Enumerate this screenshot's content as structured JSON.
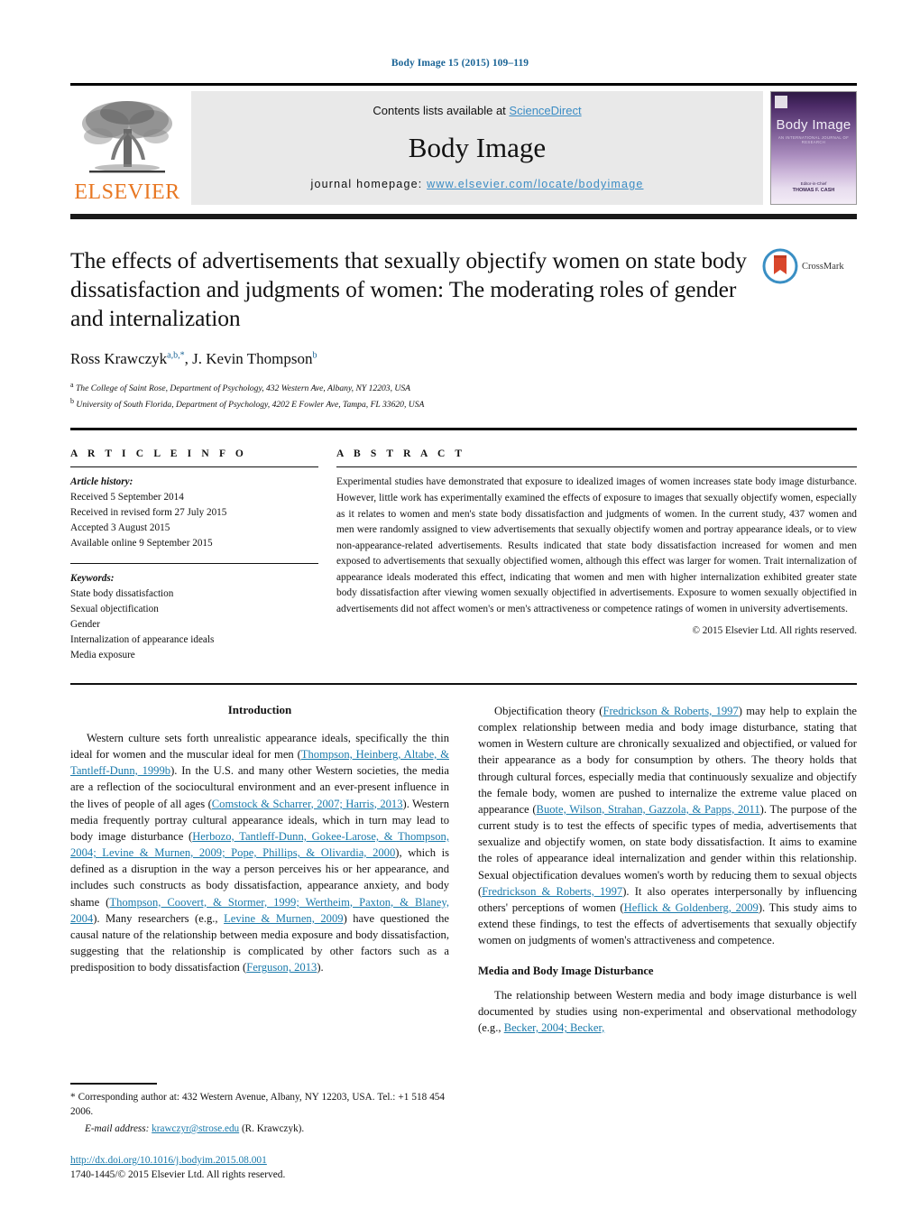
{
  "running_head": "Body Image 15 (2015) 109–119",
  "masthead": {
    "contents_prefix": "Contents lists available at ",
    "sciencedirect": "ScienceDirect",
    "journal_title": "Body Image",
    "homepage_prefix": "journal homepage: ",
    "homepage_url": "www.elsevier.com/locate/bodyimage",
    "publisher_wordmark": "ELSEVIER",
    "publisher_color": "#E87722",
    "cover": {
      "title": "Body Image",
      "subtitle": "AN INTERNATIONAL JOURNAL OF RESEARCH",
      "footer_label": "Editor-in-Chief",
      "footer_name": "THOMAS F. CASH"
    }
  },
  "article": {
    "title": "The effects of advertisements that sexually objectify women on state body dissatisfaction and judgments of women: The moderating roles of gender and internalization",
    "authors": [
      {
        "name": "Ross Krawczyk",
        "marks": "a,b,*"
      },
      {
        "name": "J. Kevin Thompson",
        "marks": "b"
      }
    ],
    "affiliations": [
      {
        "mark": "a",
        "text": "The College of Saint Rose, Department of Psychology, 432 Western Ave, Albany, NY 12203, USA"
      },
      {
        "mark": "b",
        "text": "University of South Florida, Department of Psychology, 4202 E Fowler Ave, Tampa, FL 33620, USA"
      }
    ],
    "crossmark_label": "CrossMark"
  },
  "article_info": {
    "heading": "A R T I C L E   I N F O",
    "history_label": "Article history:",
    "history": [
      "Received 5 September 2014",
      "Received in revised form 27 July 2015",
      "Accepted 3 August 2015",
      "Available online 9 September 2015"
    ],
    "keywords_label": "Keywords:",
    "keywords": [
      "State body dissatisfaction",
      "Sexual objectification",
      "Gender",
      "Internalization of appearance ideals",
      "Media exposure"
    ]
  },
  "abstract": {
    "heading": "A B S T R A C T",
    "text": "Experimental studies have demonstrated that exposure to idealized images of women increases state body image disturbance. However, little work has experimentally examined the effects of exposure to images that sexually objectify women, especially as it relates to women and men's state body dissatisfaction and judgments of women. In the current study, 437 women and men were randomly assigned to view advertisements that sexually objectify women and portray appearance ideals, or to view non-appearance-related advertisements. Results indicated that state body dissatisfaction increased for women and men exposed to advertisements that sexually objectified women, although this effect was larger for women. Trait internalization of appearance ideals moderated this effect, indicating that women and men with higher internalization exhibited greater state body dissatisfaction after viewing women sexually objectified in advertisements. Exposure to women sexually objectified in advertisements did not affect women's or men's attractiveness or competence ratings of women in university advertisements.",
    "copyright": "© 2015 Elsevier Ltd. All rights reserved."
  },
  "body": {
    "left_heading": "Introduction",
    "left_p1_parts": [
      {
        "t": "Western culture sets forth unrealistic appearance ideals, specifically the thin ideal for women and the muscular ideal for men (",
        "k": "plain"
      },
      {
        "t": "Thompson, Heinberg, Altabe, & Tantleff-Dunn, 1999b",
        "k": "ref"
      },
      {
        "t": "). In the U.S. and many other Western societies, the media are a reflection of the sociocultural environment and an ever-present influence in the lives of people of all ages (",
        "k": "plain"
      },
      {
        "t": "Comstock & Scharrer, 2007; Harris, 2013",
        "k": "ref"
      },
      {
        "t": "). Western media frequently portray cultural appearance ideals, which in turn may lead to body image disturbance (",
        "k": "plain"
      },
      {
        "t": "Herbozo, Tantleff-Dunn, Gokee-Larose, & Thompson, 2004; Levine & Murnen, 2009; Pope, Phillips, & Olivardia, 2000",
        "k": "ref"
      },
      {
        "t": "), which is defined as a disruption in the way a person perceives his or her appearance, and includes such constructs as body dissatisfaction, appearance anxiety, and body shame (",
        "k": "plain"
      },
      {
        "t": "Thompson, Coovert, & Stormer, 1999; Wertheim, Paxton, & Blaney, 2004",
        "k": "ref"
      },
      {
        "t": "). Many researchers (e.g., ",
        "k": "plain"
      },
      {
        "t": "Levine & Murnen, 2009",
        "k": "ref"
      },
      {
        "t": ") have questioned the causal nature of the relationship between media exposure and body dissatisfaction, suggesting that the relationship is complicated by other factors such as a predisposition to body dissatisfaction (",
        "k": "plain"
      },
      {
        "t": "Ferguson, 2013",
        "k": "ref"
      },
      {
        "t": ").",
        "k": "plain"
      }
    ],
    "right_p1_parts": [
      {
        "t": "Objectification theory (",
        "k": "plain"
      },
      {
        "t": "Fredrickson & Roberts, 1997",
        "k": "ref"
      },
      {
        "t": ") may help to explain the complex relationship between media and body image disturbance, stating that women in Western culture are chronically sexualized and objectified, or valued for their appearance as a body for consumption by others. The theory holds that through cultural forces, especially media that continuously sexualize and objectify the female body, women are pushed to internalize the extreme value placed on appearance (",
        "k": "plain"
      },
      {
        "t": "Buote, Wilson, Strahan, Gazzola, & Papps, 2011",
        "k": "ref"
      },
      {
        "t": "). The purpose of the current study is to test the effects of specific types of media, advertisements that sexualize and objectify women, on state body dissatisfaction. It aims to examine the roles of appearance ideal internalization and gender within this relationship. Sexual objectification devalues women's worth by reducing them to sexual objects (",
        "k": "plain"
      },
      {
        "t": "Fredrickson & Roberts, 1997",
        "k": "ref"
      },
      {
        "t": "). It also operates interpersonally by influencing others' perceptions of women (",
        "k": "plain"
      },
      {
        "t": "Heflick & Goldenberg, 2009",
        "k": "ref"
      },
      {
        "t": "). This study aims to extend these findings, to test the effects of advertisements that sexually objectify women on judgments of women's attractiveness and competence.",
        "k": "plain"
      }
    ],
    "right_heading2": "Media and Body Image Disturbance",
    "right_p2_parts": [
      {
        "t": "The relationship between Western media and body image disturbance is well documented by studies using non-experimental and observational methodology (e.g., ",
        "k": "plain"
      },
      {
        "t": "Becker, 2004; Becker,",
        "k": "ref"
      }
    ]
  },
  "footer": {
    "corresponding": "* Corresponding author at: 432 Western Avenue, Albany, NY 12203, USA. Tel.: +1 518 454 2006.",
    "email_label": "E-mail address:",
    "email": "krawczyr@strose.edu",
    "email_suffix": "(R. Krawczyk).",
    "doi": "http://dx.doi.org/10.1016/j.bodyim.2015.08.001",
    "issn_line": "1740-1445/© 2015 Elsevier Ltd. All rights reserved."
  }
}
